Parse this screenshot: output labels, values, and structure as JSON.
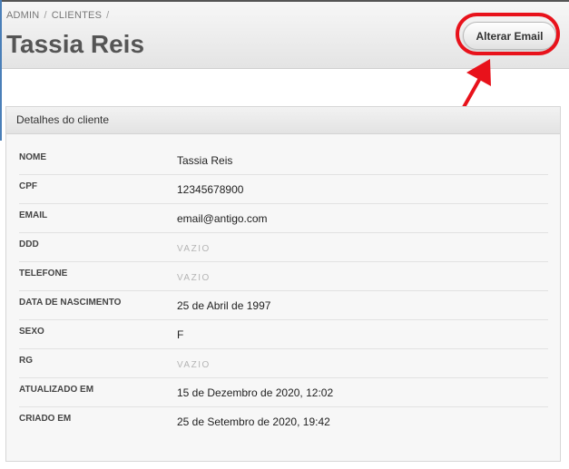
{
  "breadcrumb": [
    "ADMIN",
    "CLIENTES"
  ],
  "page_title": "Tassia Reis",
  "header_button": "Alterar Email",
  "panel_title": "Detalhes do cliente",
  "fields": [
    {
      "label": "NOME",
      "value": "Tassia Reis",
      "empty": false
    },
    {
      "label": "CPF",
      "value": "12345678900",
      "empty": false
    },
    {
      "label": "EMAIL",
      "value": "email@antigo.com",
      "empty": false
    },
    {
      "label": "DDD",
      "value": "VAZIO",
      "empty": true
    },
    {
      "label": "TELEFONE",
      "value": "VAZIO",
      "empty": true
    },
    {
      "label": "DATA DE NASCIMENTO",
      "value": "25 de Abril de 1997",
      "empty": false
    },
    {
      "label": "SEXO",
      "value": "F",
      "empty": false
    },
    {
      "label": "RG",
      "value": "VAZIO",
      "empty": true
    },
    {
      "label": "ATUALIZADO EM",
      "value": "15 de Dezembro de 2020, 12:02",
      "empty": false
    },
    {
      "label": "CRIADO EM",
      "value": "25 de Setembro de 2020, 19:42",
      "empty": false
    }
  ],
  "colors": {
    "annotation": "#e8121b",
    "title": "#555555",
    "left_border": "#4a7fb8"
  },
  "icons": [
    "annotation-arrow-icon",
    "annotation-highlight-ring"
  ]
}
